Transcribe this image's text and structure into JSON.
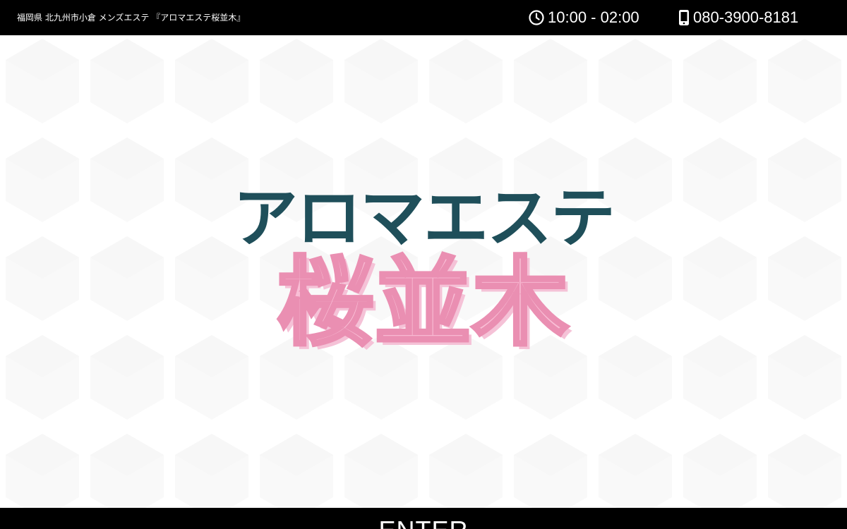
{
  "header": {
    "tagline": "福岡県 北九州市小倉 メンズエステ 『アロマエステ桜並木』",
    "hours": "10:00 - 02:00",
    "hours_icon": "clock-icon",
    "phone": "080-3900-8181",
    "phone_icon": "mobile-phone-icon"
  },
  "logo": {
    "line1": "アロマエステ",
    "line2": "桜並木"
  },
  "enter": {
    "label": "ENTER"
  },
  "colors": {
    "header_bg": "#000000",
    "logo_dark": "#1f4f5a",
    "logo_pink": "#f9bfd6",
    "logo_pink_outline": "#ea8fb2"
  }
}
